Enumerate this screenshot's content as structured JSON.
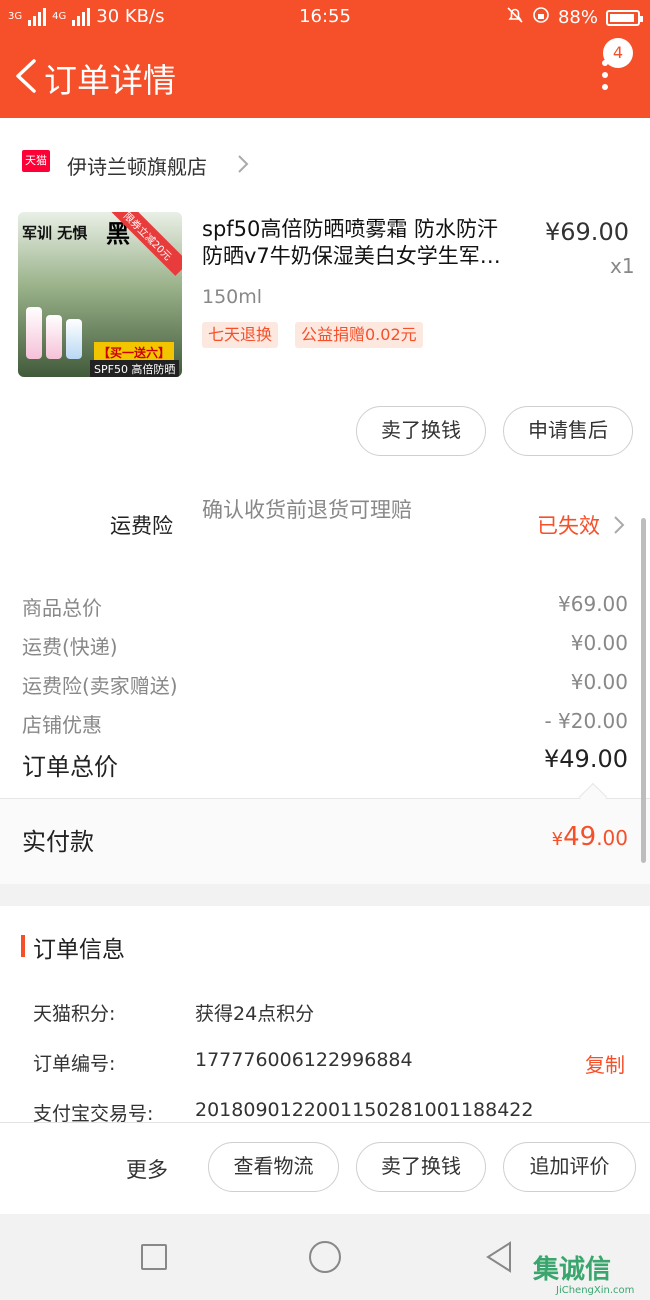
{
  "status_bar": {
    "network": "3G",
    "network2": "4G",
    "speed": "30 KB/s",
    "time": "16:55",
    "battery": "88%"
  },
  "header": {
    "title": "订单详情",
    "badge": "4"
  },
  "shop": {
    "badge": "天猫",
    "name": "伊诗兰顿旗舰店"
  },
  "product": {
    "image_text": {
      "military": "军训 无惧",
      "black": "黑",
      "ribbon": "限券立减20元",
      "promo": "【买一送六】",
      "spf": "SPF50 高倍防晒"
    },
    "title_line1": "spf50高倍防晒喷雾霜 防水防汗",
    "title_line2": "防晒v7牛奶保湿美白女学生军…",
    "price": "¥69.00",
    "qty": "x1",
    "sku": "150ml",
    "tags": [
      "七天退换",
      "公益捐赠0.02元"
    ]
  },
  "item_actions": {
    "sell": "卖了换钱",
    "after_sale": "申请售后"
  },
  "insurance": {
    "label": "运费险",
    "desc": "确认收货前退货可理赔",
    "status": "已失效"
  },
  "price_rows": [
    {
      "label": "商品总价",
      "value": "¥69.00"
    },
    {
      "label": "运费(快递)",
      "value": "¥0.00"
    },
    {
      "label": "运费险(卖家赠送)",
      "value": "¥0.00"
    },
    {
      "label": "店铺优惠",
      "value": "- ¥20.00"
    }
  ],
  "order_total": {
    "label": "订单总价",
    "value": "¥49.00"
  },
  "paid": {
    "label": "实付款",
    "yen": "¥",
    "int": "49",
    "dec": ".00"
  },
  "order_info": {
    "title": "订单信息",
    "rows": [
      {
        "label": "天猫积分:",
        "value": "获得24点积分"
      },
      {
        "label": "订单编号:",
        "value": "177776006122996884"
      },
      {
        "label": "支付宝交易号:",
        "value": "2018090122001150281001188422"
      }
    ],
    "copy": "复制"
  },
  "bottom_bar": {
    "more": "更多",
    "logistics": "查看物流",
    "sell": "卖了换钱",
    "review": "追加评价"
  },
  "watermark": {
    "text": "集诚信",
    "sub": "JiChengXin.com"
  },
  "colors": {
    "accent": "#f5502a",
    "tmall": "#ff0036"
  }
}
